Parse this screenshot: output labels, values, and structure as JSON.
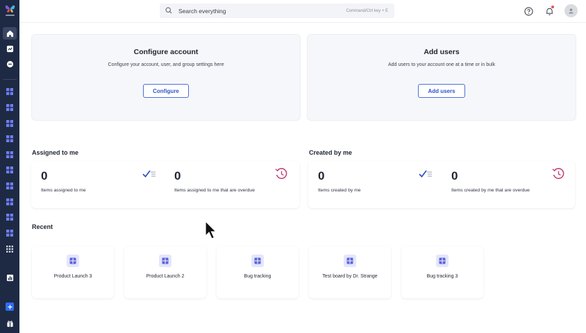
{
  "search": {
    "placeholder": "Search everything",
    "shortcut": "Command/Ctrl key + E"
  },
  "setup_cards": [
    {
      "title": "Configure account",
      "description": "Configure your account, user, and group settings here",
      "button": "Configure"
    },
    {
      "title": "Add users",
      "description": "Add users to your account one at a time or in bulk",
      "button": "Add users"
    }
  ],
  "assigned": {
    "title": "Assigned to me",
    "stats": [
      {
        "value": "0",
        "label": "Items assigned to me"
      },
      {
        "value": "0",
        "label": "Items assigned to me that are overdue"
      }
    ]
  },
  "created": {
    "title": "Created by me",
    "stats": [
      {
        "value": "0",
        "label": "Items created by me"
      },
      {
        "value": "0",
        "label": "Items created by me that are overdue"
      }
    ]
  },
  "recent": {
    "title": "Recent",
    "items": [
      {
        "label": "Product Launch 3"
      },
      {
        "label": "Product Launch 2"
      },
      {
        "label": "Bug tracking"
      },
      {
        "label": "Test board by Dr. Strange"
      },
      {
        "label": "Bug tracking 3"
      }
    ]
  },
  "icons": {
    "logo": "butterfly-logo-icon",
    "home": "home-icon",
    "search": "search-icon",
    "help": "help-circle-icon",
    "bell": "bell-icon",
    "checklist": "checklist-icon",
    "overdue": "clock-history-icon",
    "board": "board-icon"
  },
  "colors": {
    "sidebar": "#1e2a44",
    "accent": "#2f55c8",
    "overdue_icon": "#c2427a",
    "check_icon": "#2f55c8",
    "notif_dot": "#e25555"
  }
}
